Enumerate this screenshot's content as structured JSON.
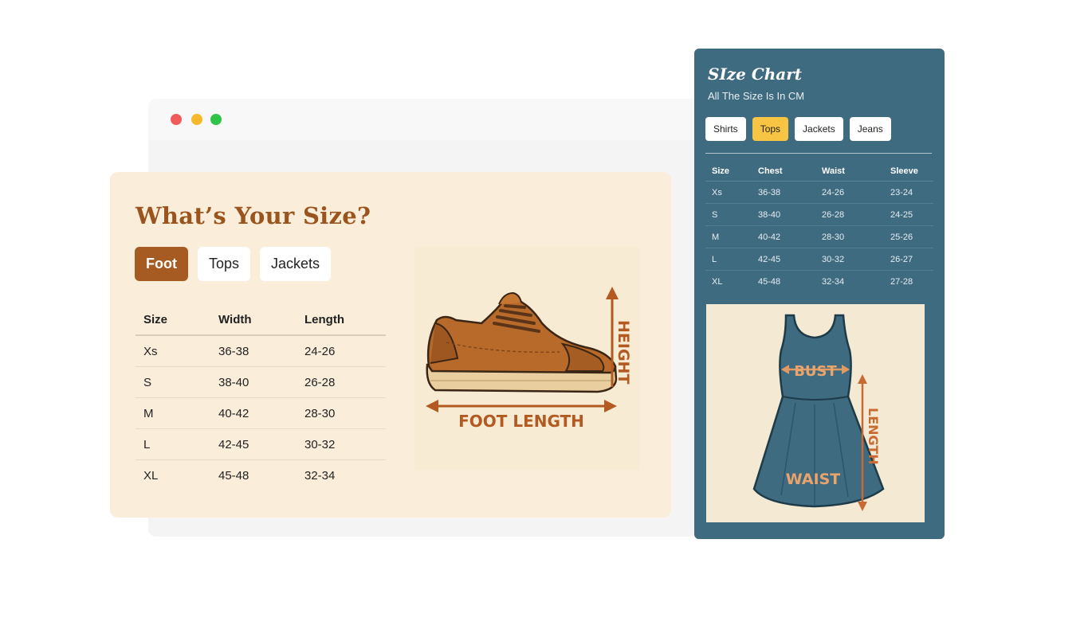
{
  "card": {
    "title": "What’s Your Size?",
    "tabs": [
      {
        "label": "Foot",
        "active": true
      },
      {
        "label": "Tops",
        "active": false
      },
      {
        "label": "Jackets",
        "active": false
      }
    ],
    "table": {
      "headers": [
        "Size",
        "Width",
        "Length"
      ],
      "rows": [
        [
          "Xs",
          "36-38",
          "24-26"
        ],
        [
          "S",
          "38-40",
          "26-28"
        ],
        [
          "M",
          "40-42",
          "28-30"
        ],
        [
          "L",
          "42-45",
          "30-32"
        ],
        [
          "XL",
          "45-48",
          "32-34"
        ]
      ]
    },
    "shoe_labels": {
      "height": "HEIGHT",
      "foot_length": "FOOT LENGTH"
    }
  },
  "panel": {
    "title": "SIze Chart",
    "subtitle": "All The Size Is In CM",
    "tabs": [
      {
        "label": "Shirts",
        "active": false
      },
      {
        "label": "Tops",
        "active": true
      },
      {
        "label": "Jackets",
        "active": false
      },
      {
        "label": "Jeans",
        "active": false
      }
    ],
    "table": {
      "headers": [
        "Size",
        "Chest",
        "Waist",
        "Sleeve"
      ],
      "rows": [
        [
          "Xs",
          "36-38",
          "24-26",
          "23-24"
        ],
        [
          "S",
          "38-40",
          "26-28",
          "24-25"
        ],
        [
          "M",
          "40-42",
          "28-30",
          "25-26"
        ],
        [
          "L",
          "42-45",
          "30-32",
          "26-27"
        ],
        [
          "XL",
          "45-48",
          "32-34",
          "27-28"
        ]
      ]
    },
    "dress_labels": {
      "bust": "BUST",
      "waist": "WAIST",
      "length": "LENGTH"
    }
  },
  "colors": {
    "accent_brown": "#a55b22",
    "panel_blue": "#3f6b81",
    "tab_yellow": "#f7c444",
    "card_beige": "#faeedb"
  }
}
